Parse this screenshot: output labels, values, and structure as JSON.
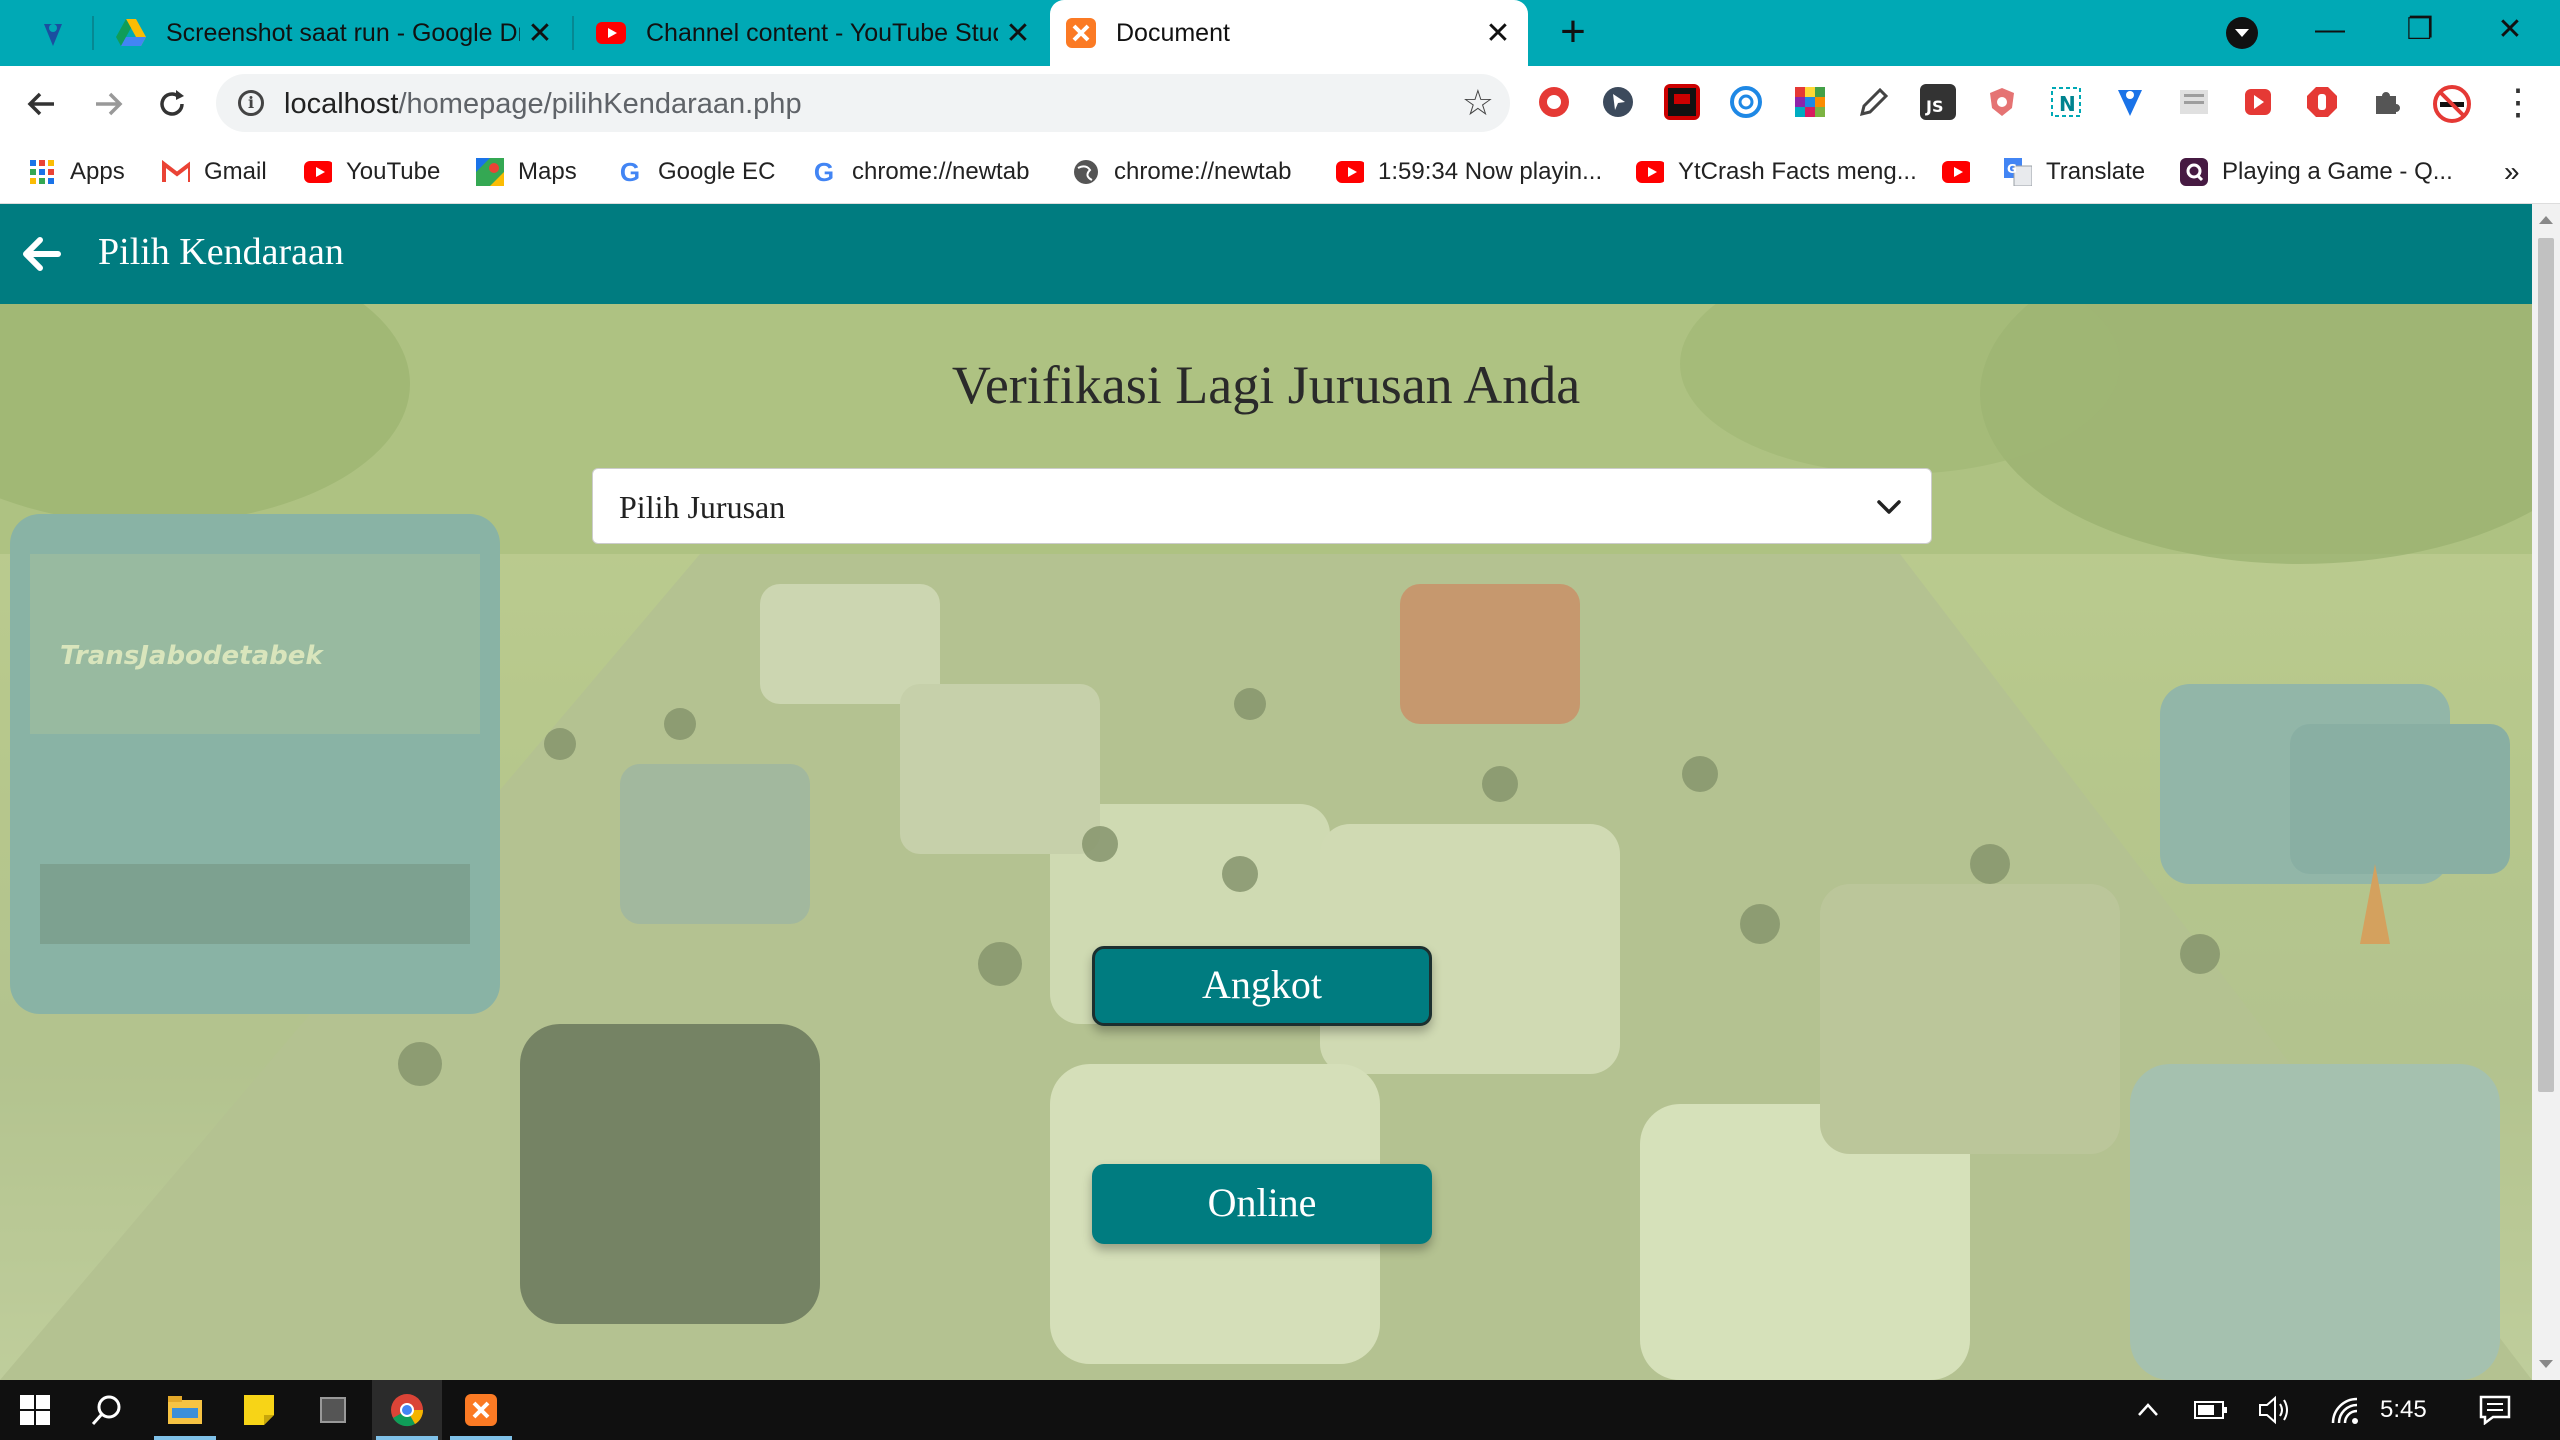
{
  "browser": {
    "tabs": [
      {
        "title": "",
        "icon": "maps-pin-icon"
      },
      {
        "title": "Screenshot saat run - Google Dri",
        "icon": "google-drive-icon",
        "close": "✕"
      },
      {
        "title": "Channel content - YouTube Studi",
        "icon": "youtube-icon",
        "close": "✕"
      },
      {
        "title": "Document",
        "icon": "xampp-icon",
        "close": "✕",
        "active": true
      }
    ],
    "new_tab": "+",
    "window_controls": {
      "minimize": "—",
      "restore": "❐",
      "close": "✕"
    },
    "address": {
      "host": "localhost",
      "path": "/homepage/pilihKendaraan.php"
    },
    "bookmarks": [
      {
        "label": "Apps",
        "icon": "apps-grid-icon"
      },
      {
        "label": "Gmail",
        "icon": "gmail-icon"
      },
      {
        "label": "YouTube",
        "icon": "youtube-icon"
      },
      {
        "label": "Maps",
        "icon": "maps-icon"
      },
      {
        "label": "Google EC",
        "icon": "google-icon"
      },
      {
        "label": "chrome://newtab",
        "icon": "google-icon"
      },
      {
        "label": "chrome://newtab",
        "icon": "globe-icon"
      },
      {
        "label": "1:59:34 Now playin...",
        "icon": "youtube-icon"
      },
      {
        "label": "YtCrash Facts meng...",
        "icon": "youtube-icon"
      },
      {
        "label": "",
        "icon": "youtube-icon"
      },
      {
        "label": "Translate",
        "icon": "translate-icon"
      },
      {
        "label": "Playing a Game - Q...",
        "icon": "quizizz-icon"
      }
    ],
    "bookmarks_overflow": "»"
  },
  "page": {
    "appbar_title": "Pilih Kendaraan",
    "heading": "Verifikasi Lagi Jurusan Anda",
    "select": {
      "value": "Pilih Jurusan"
    },
    "buttons": {
      "angkot": "Angkot",
      "online": "Online"
    }
  },
  "colors": {
    "tabstrip": "#00a9b5",
    "appbar": "#007c80",
    "button": "#007c80"
  },
  "taskbar": {
    "clock": "5:45"
  }
}
